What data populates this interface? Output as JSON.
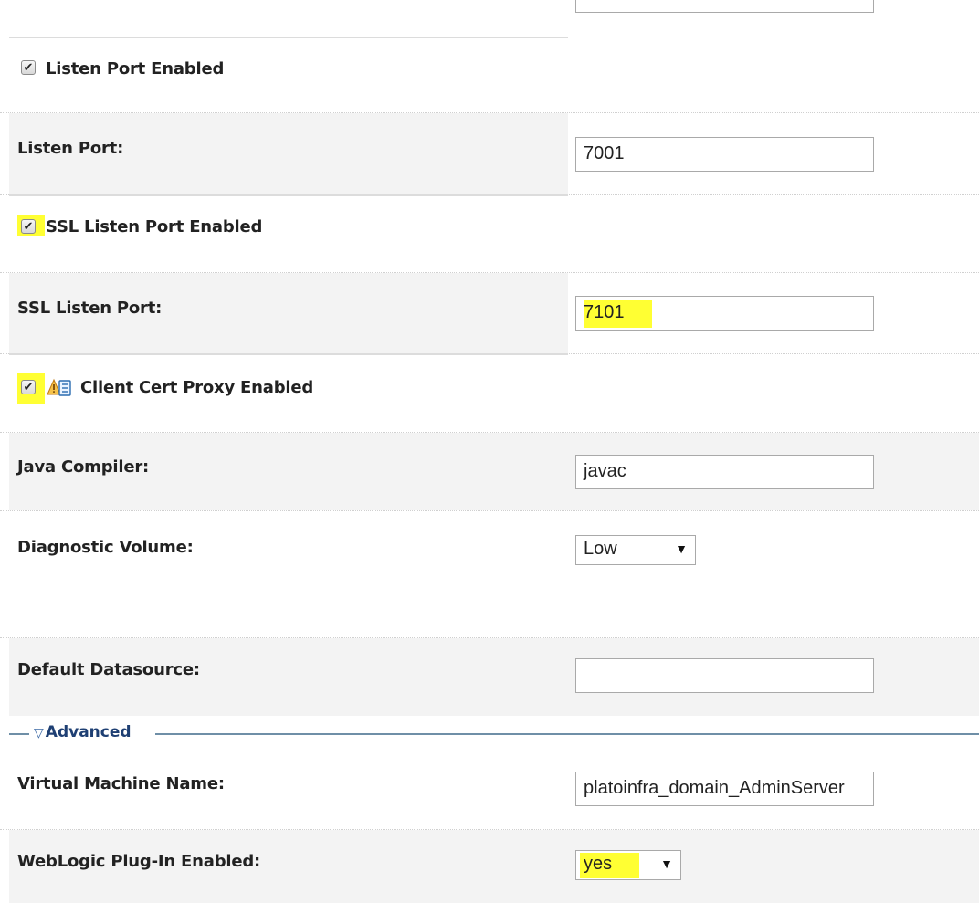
{
  "fields": {
    "listen_port_enabled": {
      "label": "Listen Port Enabled",
      "checked": true
    },
    "listen_port": {
      "label": "Listen Port:",
      "value": "7001"
    },
    "ssl_listen_port_enabled": {
      "label": "SSL Listen Port Enabled",
      "checked": true
    },
    "ssl_listen_port": {
      "label": "SSL Listen Port:",
      "value": "7101"
    },
    "client_cert_proxy_enabled": {
      "label": "Client Cert Proxy Enabled",
      "checked": true,
      "icon": "warning-icon"
    },
    "java_compiler": {
      "label": "Java Compiler:",
      "value": "javac"
    },
    "diagnostic_volume": {
      "label": "Diagnostic Volume:",
      "value": "Low"
    },
    "default_datasource": {
      "label": "Default Datasource:",
      "value": ""
    },
    "virtual_machine_name": {
      "label": "Virtual Machine Name:",
      "value": "platoinfra_domain_AdminServer"
    },
    "weblogic_plugin_enabled": {
      "label": "WebLogic Plug-In Enabled:",
      "value": "yes"
    }
  },
  "advanced": {
    "label": "Advanced",
    "icon": "triangle-down-icon"
  },
  "icons": {
    "checkmark": "✔",
    "dropdown": "▼",
    "collapse": "▽"
  },
  "colors": {
    "highlight": "#ffff33",
    "section_link": "#1e3f73",
    "row_shade": "#f3f3f3"
  }
}
